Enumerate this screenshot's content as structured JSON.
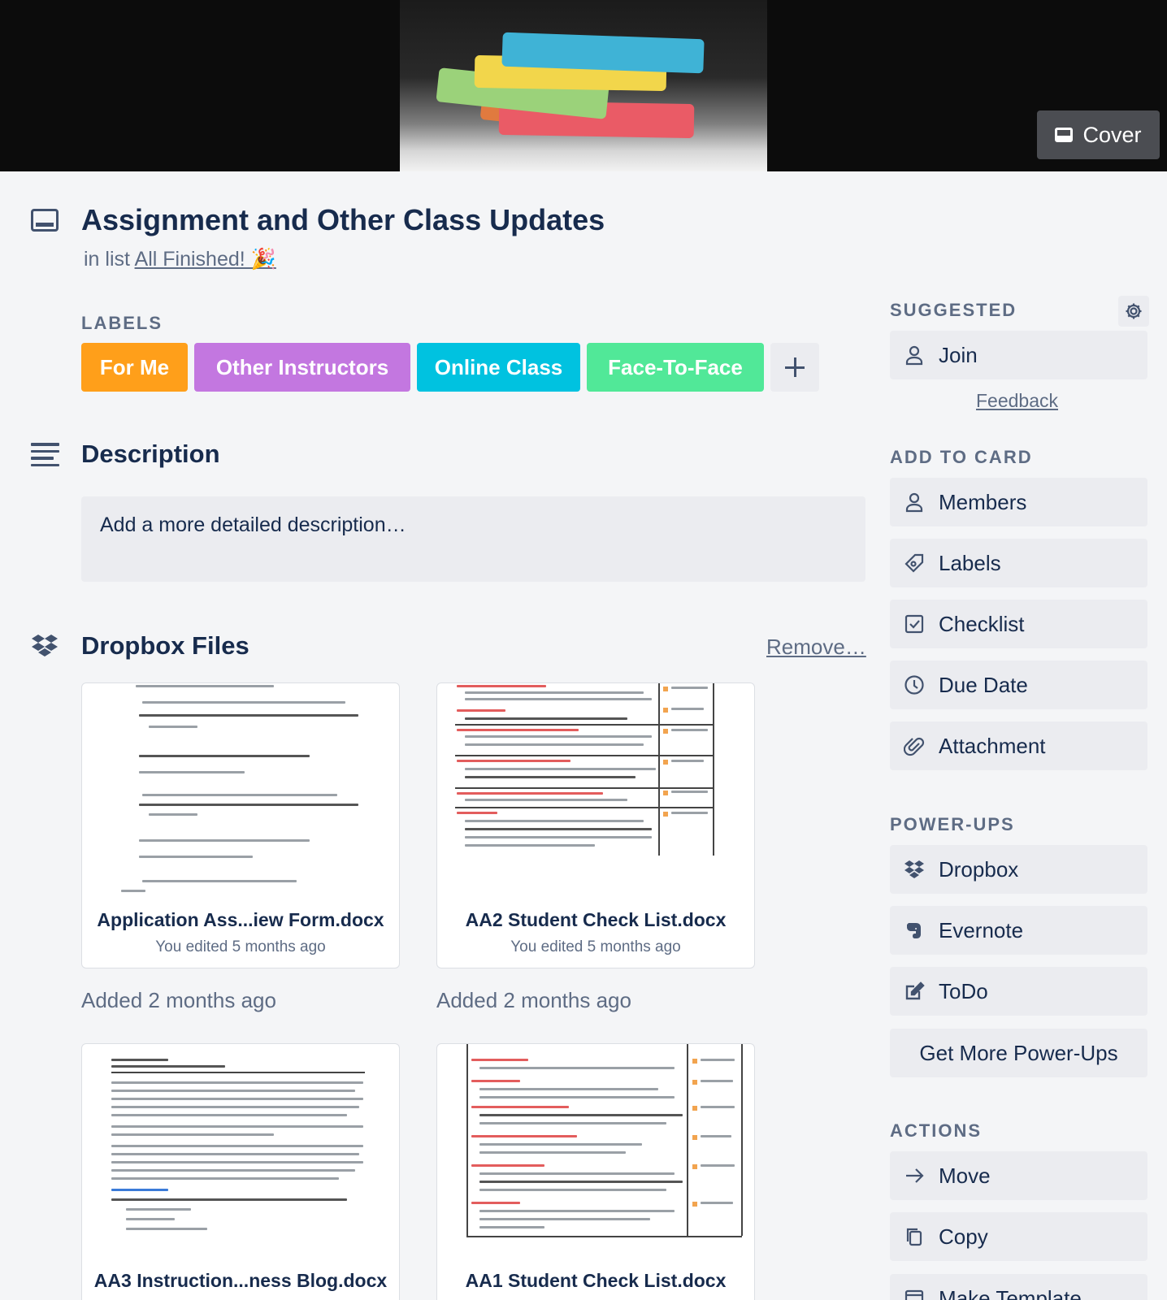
{
  "cover": {
    "button_label": "Cover"
  },
  "card": {
    "title": "Assignment and Other Class Updates",
    "list_prefix": "in list",
    "list_name": "All Finished! 🎉"
  },
  "labels": {
    "heading": "LABELS",
    "items": [
      {
        "text": "For Me",
        "color": "#ff9f1a"
      },
      {
        "text": "Other Instructors",
        "color": "#c377e0"
      },
      {
        "text": "Online Class",
        "color": "#00c2e0"
      },
      {
        "text": "Face-To-Face",
        "color": "#51e898"
      }
    ]
  },
  "description": {
    "heading": "Description",
    "placeholder": "Add a more detailed description…"
  },
  "dropbox": {
    "heading": "Dropbox Files",
    "remove_label": "Remove…",
    "files": [
      {
        "name": "Application Ass...iew Form.docx",
        "edited": "You edited 5 months ago",
        "added": "Added 2 months ago"
      },
      {
        "name": "AA2 Student Check List.docx",
        "edited": "You edited 5 months ago",
        "added": "Added 2 months ago"
      },
      {
        "name": "AA3 Instruction...ness Blog.docx"
      },
      {
        "name": "AA1 Student Check List.docx"
      }
    ]
  },
  "sidebar": {
    "suggested": {
      "heading": "SUGGESTED",
      "join_label": "Join",
      "feedback_label": "Feedback"
    },
    "add_to_card": {
      "heading": "ADD TO CARD",
      "items": [
        {
          "label": "Members",
          "icon": "person-icon"
        },
        {
          "label": "Labels",
          "icon": "tag-icon"
        },
        {
          "label": "Checklist",
          "icon": "checkbox-icon"
        },
        {
          "label": "Due Date",
          "icon": "clock-icon"
        },
        {
          "label": "Attachment",
          "icon": "paperclip-icon"
        }
      ]
    },
    "power_ups": {
      "heading": "POWER-UPS",
      "items": [
        {
          "label": "Dropbox",
          "icon": "dropbox-icon"
        },
        {
          "label": "Evernote",
          "icon": "evernote-icon"
        },
        {
          "label": "ToDo",
          "icon": "edit-icon"
        }
      ],
      "more_label": "Get More Power-Ups"
    },
    "actions": {
      "heading": "ACTIONS",
      "items": [
        {
          "label": "Move",
          "icon": "arrow-right-icon"
        },
        {
          "label": "Copy",
          "icon": "copy-icon"
        },
        {
          "label": "Make Template",
          "icon": "template-icon"
        }
      ]
    }
  }
}
